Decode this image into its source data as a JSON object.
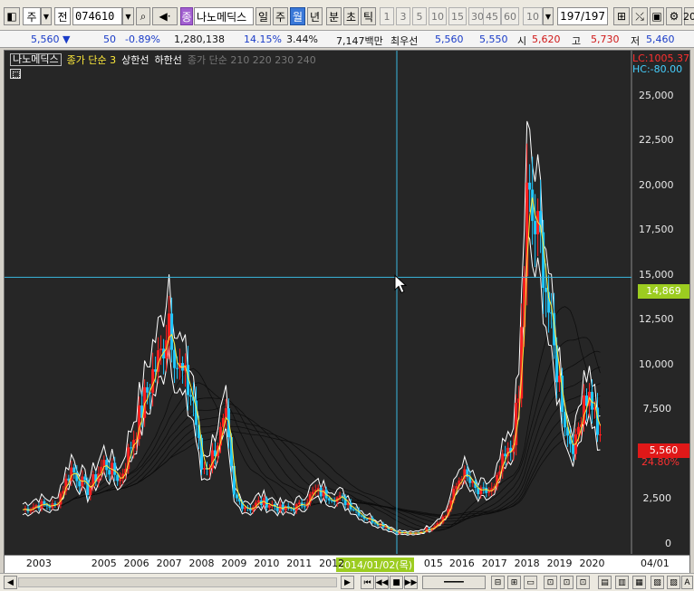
{
  "toolbar": {
    "period_label": "주",
    "prev_label": "전",
    "stock_code": "074610",
    "search_icon": "magnifier-icon",
    "sound_icon": "speaker-icon",
    "badge": "종",
    "stock_name": "나노메딕스",
    "tabs": [
      "일",
      "주",
      "월",
      "년",
      "분",
      "초",
      "틱"
    ],
    "active_tab": "월",
    "quick_nums": [
      "1",
      "3",
      "5",
      "10",
      "15",
      "30",
      "45",
      "60"
    ],
    "interval_value": "10",
    "count_value": "197/197",
    "edge_label": "20"
  },
  "quote": {
    "price": "5,560",
    "arrow": "▼",
    "change": "50",
    "change_pct": "-0.89%",
    "volume": "1,280,138",
    "turnover_pct": "14.15%",
    "ratio_pct": "3.44%",
    "amount": "7,147백만",
    "best_ask_label": "최우선",
    "best_ask": "5,560",
    "best_bid": "5,550",
    "open_label": "시",
    "open": "5,620",
    "high_label": "고",
    "high": "5,730",
    "low_label": "저",
    "low": "5,460"
  },
  "chart": {
    "legend_name": "나노메딕스",
    "legend_ma": "종가 단순 3",
    "legend_upper": "상한선",
    "legend_lower": "하한선",
    "legend_ma_long": "종가 단순 210 220 230 240",
    "lc_label": "LC:1005.37",
    "hc_label": "HC:-80.00",
    "cursor_price": "14,869",
    "current_price": "5,560",
    "current_pct": "24.80%",
    "y_ticks": [
      "25,000",
      "22,500",
      "20,000",
      "17,500",
      "15,000",
      "12,500",
      "10,000",
      "7,500",
      "5,000",
      "2,500",
      "0"
    ],
    "x_ticks": [
      "2003",
      "2005",
      "2006",
      "2007",
      "2008",
      "2009",
      "2010",
      "2011",
      "2012",
      "015",
      "2016",
      "2017",
      "2018",
      "2019",
      "2020",
      "04/01"
    ],
    "cursor_date": "2014/01/02(목)",
    "colors": {
      "up": "#ff2020",
      "down": "#20c8ff",
      "ma": "#ffeb3b",
      "band": "#ffffff",
      "crosshair": "#3ab8e0"
    }
  },
  "chart_data": {
    "type": "candlestick",
    "title": "",
    "xlabel": "",
    "ylabel": "",
    "ylim": [
      0,
      27500
    ],
    "x": [
      "2002-07",
      "2003-01",
      "2003-07",
      "2004-01",
      "2004-07",
      "2005-01",
      "2005-07",
      "2006-01",
      "2006-04",
      "2006-07",
      "2006-10",
      "2007-01",
      "2007-04",
      "2007-07",
      "2007-10",
      "2008-01",
      "2008-04",
      "2008-07",
      "2008-10",
      "2009-01",
      "2009-04",
      "2009-07",
      "2009-10",
      "2010-01",
      "2010-07",
      "2011-01",
      "2011-07",
      "2012-01",
      "2012-07",
      "2013-01",
      "2013-07",
      "2014-01",
      "2014-07",
      "2015-01",
      "2015-07",
      "2016-01",
      "2016-07",
      "2017-01",
      "2017-04",
      "2017-07",
      "2017-10",
      "2018-01",
      "2018-04",
      "2018-07",
      "2018-10",
      "2019-01",
      "2019-04",
      "2019-07",
      "2019-10",
      "2020-01",
      "2020-04"
    ],
    "series": [
      {
        "name": "나노메딕스",
        "values": [
          1900,
          2200,
          2100,
          4200,
          3000,
          4500,
          3600,
          6500,
          8000,
          9500,
          10500,
          13000,
          10000,
          9000,
          8000,
          4200,
          4500,
          5800,
          6800,
          2600,
          2200,
          2000,
          2300,
          2300,
          1900,
          2100,
          2900,
          2700,
          2300,
          1500,
          1100,
          650,
          550,
          850,
          1600,
          4000,
          2800,
          3000,
          4500,
          5200,
          8000,
          19000,
          17500,
          16000,
          11500,
          9000,
          6000,
          5500,
          8500,
          8000,
          5560
        ]
      }
    ]
  }
}
